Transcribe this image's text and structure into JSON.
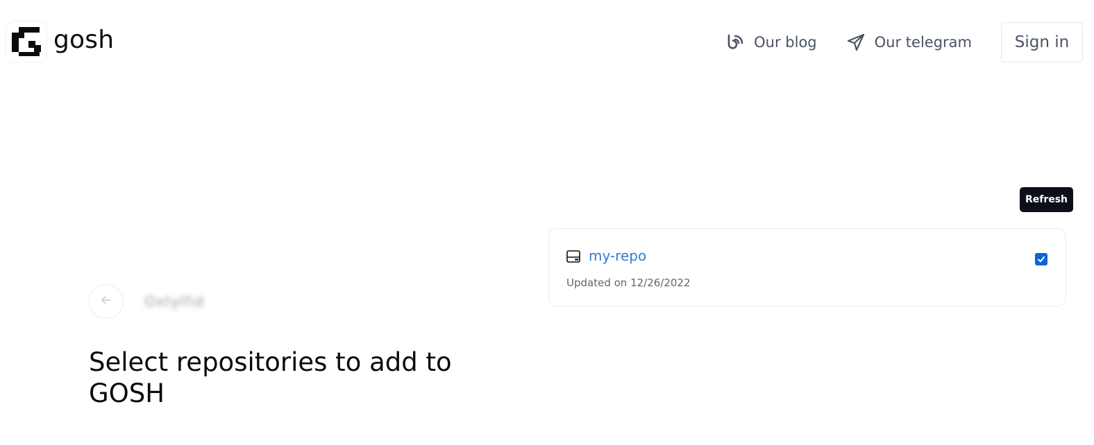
{
  "header": {
    "logo_text": "gosh",
    "nav": [
      {
        "label": "Our blog",
        "icon": "blog-icon"
      },
      {
        "label": "Our telegram",
        "icon": "telegram-icon"
      }
    ],
    "signin_label": "Sign in"
  },
  "back": {
    "account_name": "Oxtylfid"
  },
  "page": {
    "title": "Select repositories to add to GOSH"
  },
  "actions": {
    "refresh_label": "Refresh"
  },
  "repos": [
    {
      "name": "my-repo",
      "updated": "Updated on 12/26/2022",
      "selected": true,
      "icon": "repository-icon"
    }
  ],
  "colors": {
    "accent": "#2f7fd3",
    "checkbox": "#0b65d8",
    "dark_button": "#0b1018",
    "nav_text": "#4a5361"
  }
}
